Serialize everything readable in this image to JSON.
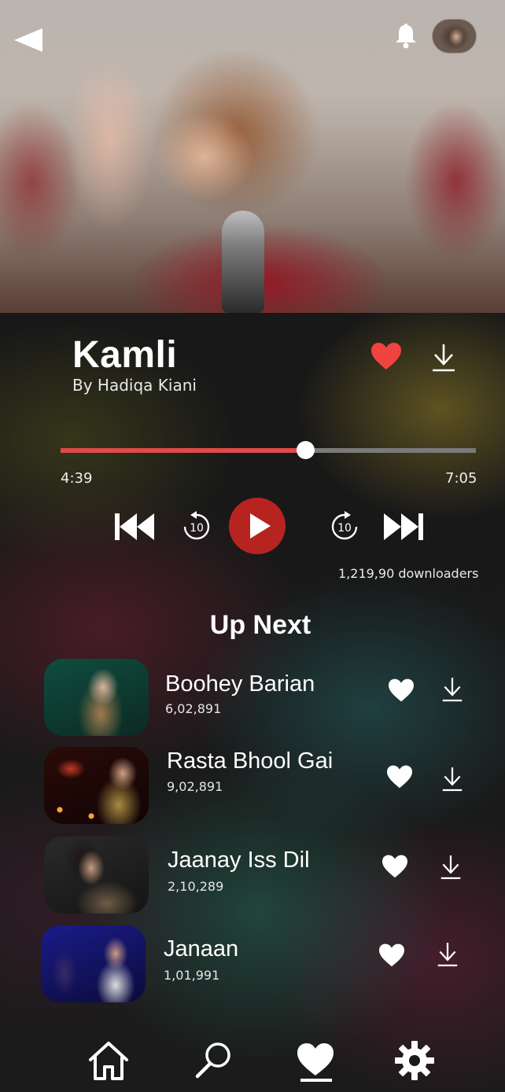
{
  "now_playing": {
    "title": "Kamli",
    "artist": "By Hadiqa Kiani",
    "elapsed": "4:39",
    "duration": "7:05",
    "progress_fraction": 0.589,
    "downloads": "1,219,90 downloaders",
    "liked": true
  },
  "controls": {
    "rewind_seconds": "10",
    "forward_seconds": "10"
  },
  "up_next": {
    "title": "Up Next",
    "tracks": [
      {
        "name": "Boohey Barian",
        "count": "6,02,891"
      },
      {
        "name": "Rasta Bhool Gai",
        "count": "9,02,891"
      },
      {
        "name": "Jaanay Iss Dil",
        "count": "2,10,289"
      },
      {
        "name": "Janaan",
        "count": "1,01,991"
      }
    ]
  },
  "colors": {
    "accent": "#e04a48",
    "play_button": "#b7241f",
    "liked_heart": "#f0433f"
  },
  "icons": {
    "back": "back-arrow-icon",
    "bell": "bell-icon",
    "like": "heart-icon",
    "download": "download-icon",
    "prev": "skip-previous-icon",
    "next": "skip-next-icon",
    "rewind": "replay-10-icon",
    "forward": "forward-10-icon",
    "play": "play-icon",
    "home": "home-icon",
    "search": "search-icon",
    "favorites": "heart-icon",
    "settings": "gear-icon"
  }
}
